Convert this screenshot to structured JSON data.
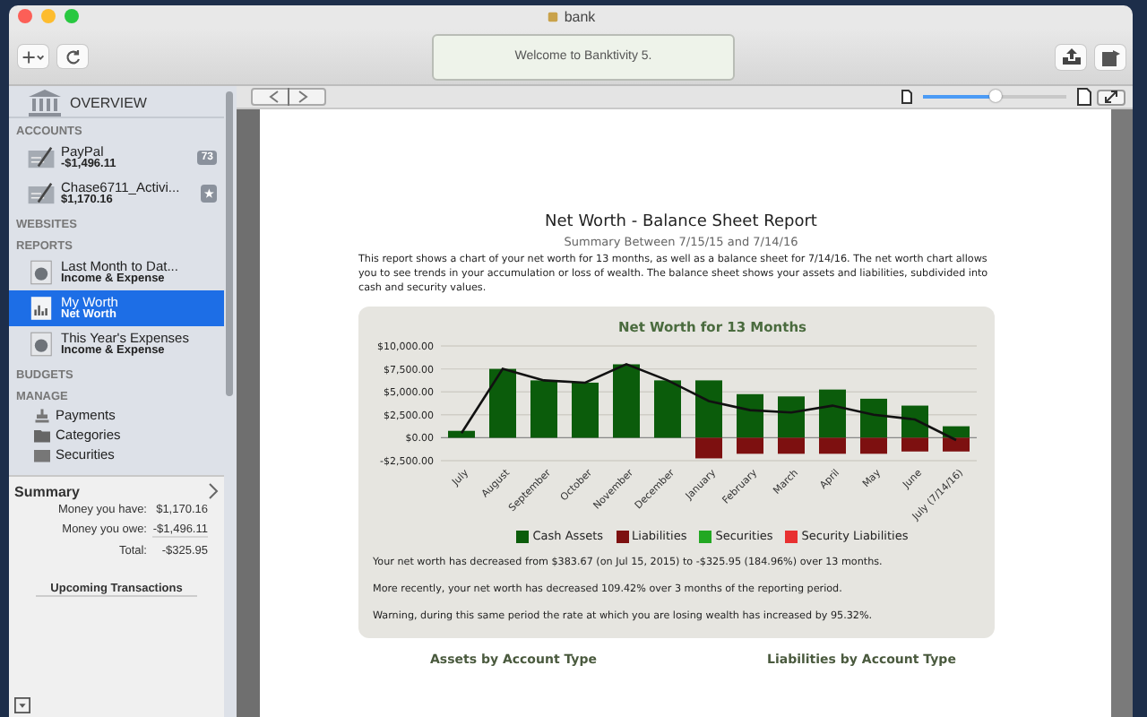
{
  "window": {
    "title": "bank"
  },
  "toolbar": {
    "welcome": "Welcome to Banktivity 5.",
    "zoom": {
      "level": 0.5
    }
  },
  "sidebar": {
    "overview": "OVERVIEW",
    "sections": [
      {
        "title": "ACCOUNTS",
        "items": [
          {
            "kind": "account",
            "name": "PayPal",
            "detail": "-$1,496.11",
            "badge": "73",
            "selected": false
          },
          {
            "kind": "account",
            "name": "Chase6711_Activi...",
            "detail": "$1,170.16",
            "badge": "★",
            "selected": false
          }
        ]
      },
      {
        "title": "WEBSITES"
      },
      {
        "title": "REPORTS",
        "items": [
          {
            "kind": "pie-report",
            "name": "Last Month to Dat...",
            "detail": "Income & Expense",
            "selected": false
          },
          {
            "kind": "bar-report",
            "name": "My Worth",
            "detail": "Net Worth",
            "selected": true
          },
          {
            "kind": "pie-report",
            "name": "This Year's Expenses",
            "detail": "Income & Expense",
            "selected": false
          }
        ]
      },
      {
        "title": "BUDGETS"
      },
      {
        "title": "MANAGE",
        "items": [
          {
            "kind": "payments",
            "name": "Payments",
            "selected": false
          },
          {
            "kind": "categories",
            "name": "Categories",
            "selected": false
          },
          {
            "kind": "securities",
            "name": "Securities",
            "selected": false
          }
        ]
      }
    ]
  },
  "summary": {
    "title": "Summary",
    "rows": [
      {
        "label": "Money you have:",
        "value": "$1,170.16"
      },
      {
        "label": "Money you owe:",
        "value": "-$1,496.11"
      },
      {
        "label": "Total:",
        "value": "-$325.95"
      }
    ],
    "upcoming": "Upcoming Transactions"
  },
  "report": {
    "title": "Net Worth - Balance Sheet Report",
    "subtitle": "Summary Between 7/15/15 and 7/14/16",
    "intro": "This report shows a chart of your net worth for 13 months, as well as a balance sheet for 7/14/16. The net worth chart allows you to see trends in your accumulation or loss of wealth. The balance sheet shows your assets and liabilities, subdivided into cash and security values.",
    "chart": {
      "chart_data": {
        "type": "bar",
        "title": "Net Worth for 13 Months",
        "stacked": true,
        "categories": [
          "July",
          "August",
          "September",
          "October",
          "November",
          "December",
          "January",
          "February",
          "March",
          "April",
          "May",
          "June",
          "July (7/14/16)"
        ],
        "series": [
          {
            "name": "Cash Assets",
            "color": "#0b5c0b",
            "values": [
              750,
              7500,
              6250,
              6000,
              8000,
              6250,
              6250,
              4750,
              4500,
              5250,
              4250,
              3500,
              1250
            ]
          },
          {
            "name": "Liabilities",
            "color": "#7d1010",
            "values": [
              0,
              0,
              0,
              0,
              0,
              0,
              -2250,
              -1750,
              -1750,
              -1750,
              -1750,
              -1500,
              -1500
            ]
          },
          {
            "name": "Securities",
            "color": "#22a822",
            "values": [
              0,
              0,
              0,
              0,
              0,
              0,
              0,
              0,
              0,
              0,
              0,
              0,
              0
            ]
          },
          {
            "name": "Security Liabilities",
            "color": "#e83030",
            "values": [
              0,
              0,
              0,
              0,
              0,
              0,
              0,
              0,
              0,
              0,
              0,
              0,
              0
            ]
          },
          {
            "type": "line",
            "color": "#111111",
            "values": [
              500,
              7500,
              6250,
              6000,
              8000,
              6250,
              4000,
              3000,
              2750,
              3500,
              2500,
              2000,
              -250
            ]
          }
        ],
        "grid": true,
        "legend": true,
        "ylim": [
          -2500,
          10000
        ],
        "yticks": [
          {
            "value": 10000,
            "label": "$10,000.00"
          },
          {
            "value": 7500,
            "label": "$7,500.00"
          },
          {
            "value": 5000,
            "label": "$5,000.00"
          },
          {
            "value": 2500,
            "label": "$2,500.00"
          },
          {
            "value": 0,
            "label": "$0.00"
          },
          {
            "value": -2500,
            "label": "-$2,500.00"
          }
        ]
      }
    },
    "notes": [
      "Your net worth has decreased from $383.67 (on Jul 15, 2015) to -$325.95 (184.96%) over 13 months.",
      "More recently, your net worth has decreased 109.42% over 3 months of the reporting period.",
      "Warning, during this same period the rate at which you are losing wealth has increased by 95.32%."
    ],
    "section_headings": [
      "Assets by Account Type",
      "Liabilities by Account Type"
    ]
  }
}
